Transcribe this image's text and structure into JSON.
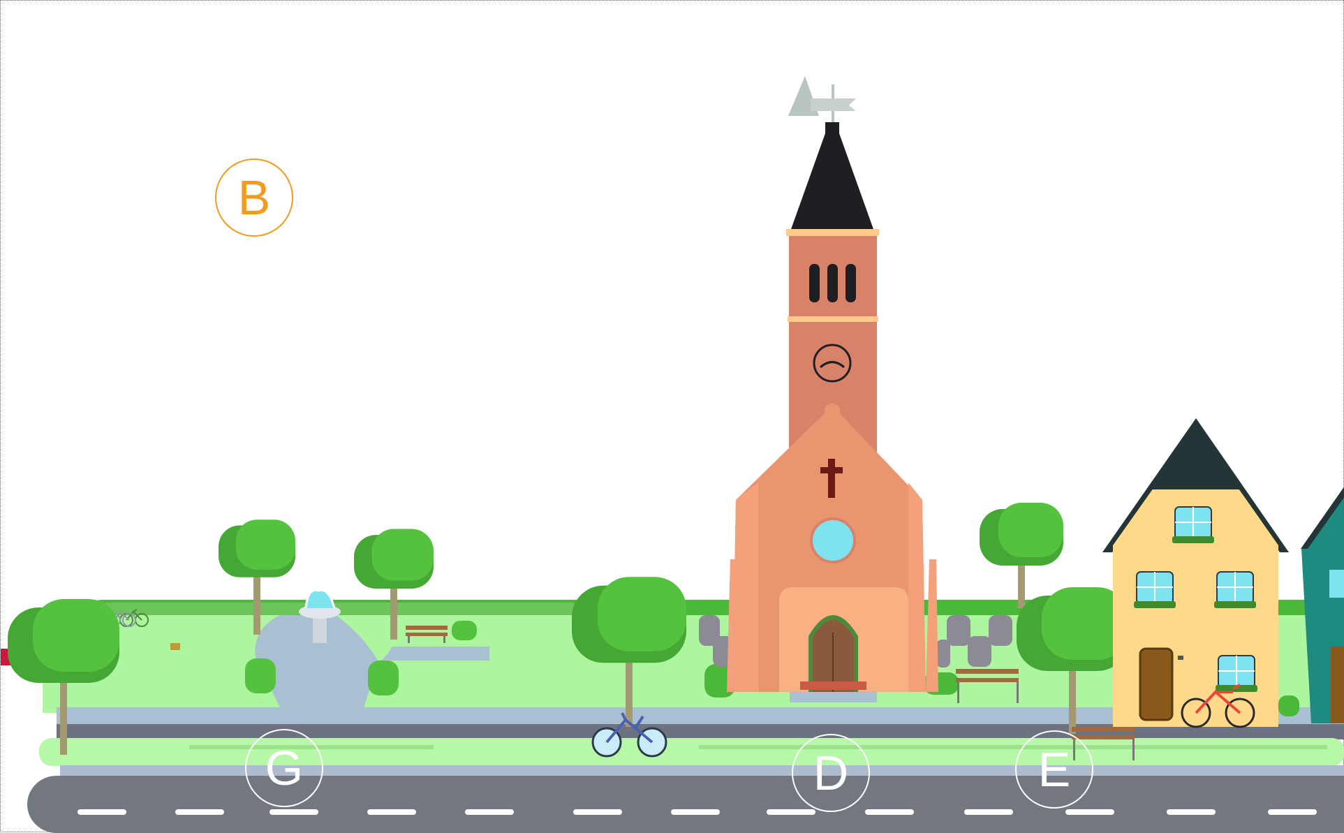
{
  "markers": {
    "b": "B",
    "g": "G",
    "d": "D",
    "e": "E"
  },
  "colors": {
    "orange_marker": "#f29c1f",
    "white_marker": "#ffffff",
    "grass": "#aef5a0",
    "tree": "#55c23f",
    "road": "#737880",
    "sidewalk": "#a9c0d2",
    "church_wall": "#e89570",
    "tower": "#d9826a",
    "spire": "#1e1f22",
    "house_yellow": "#ffd98a",
    "house_teal": "#1f8a80"
  },
  "icons": [
    "church-icon",
    "house-icon",
    "tree-icon",
    "bicycle-icon",
    "bench-icon",
    "fountain-icon",
    "picnic-blanket-icon",
    "bush-icon",
    "gravestone-icon"
  ]
}
